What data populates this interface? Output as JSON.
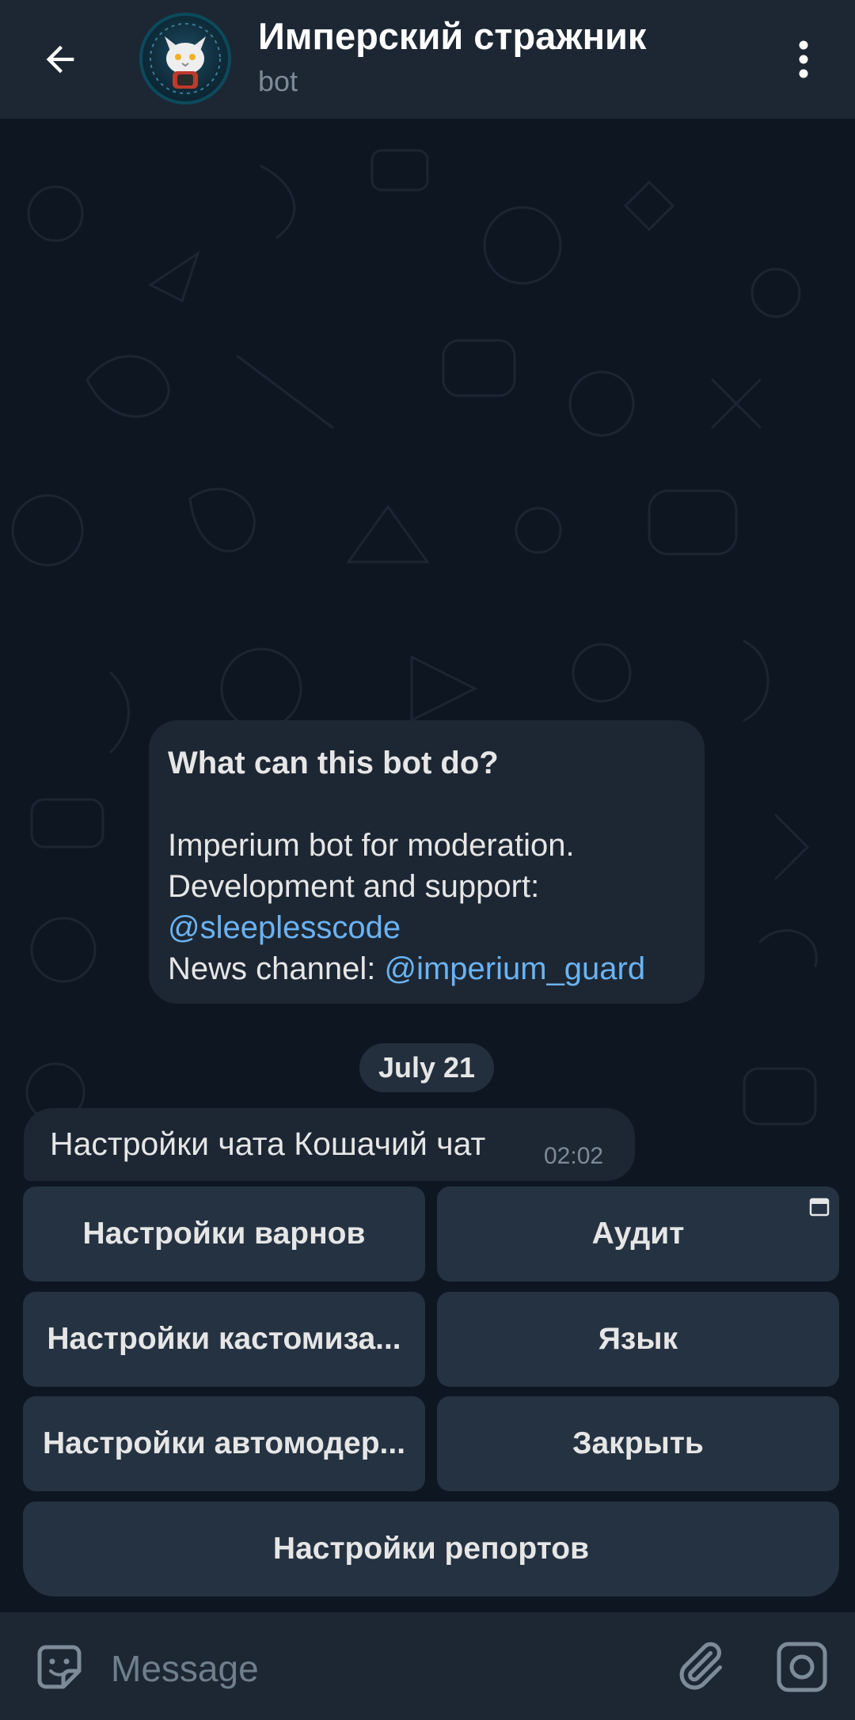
{
  "header": {
    "title": "Имперский стражник",
    "subtitle": "bot",
    "back_icon": "arrow-left-icon",
    "menu_icon": "more-vertical-icon"
  },
  "intro": {
    "heading": "What can this bot do?",
    "line1": "Imperium bot for moderation.",
    "line2": "Development and support:",
    "support_link": "@sleeplesscode",
    "news_label": "News channel: ",
    "news_link": "@imperium_guard"
  },
  "date_separator": "July 21",
  "message": {
    "text": "Настройки чата Кошачий чат",
    "time": "02:02"
  },
  "keyboard": {
    "warns": "Настройки варнов",
    "audit": "Аудит",
    "customization": "Настройки кастомиза...",
    "language": "Язык",
    "automod": "Настройки автомодер...",
    "close": "Закрыть",
    "reports": "Настройки репортов"
  },
  "input": {
    "placeholder": "Message"
  },
  "colors": {
    "background": "#0e1621",
    "header": "#1d2733",
    "bubble": "#1d2733",
    "keyboard_button": "#253241",
    "link": "#6ab3f3",
    "secondary_text": "#7d8b99"
  }
}
